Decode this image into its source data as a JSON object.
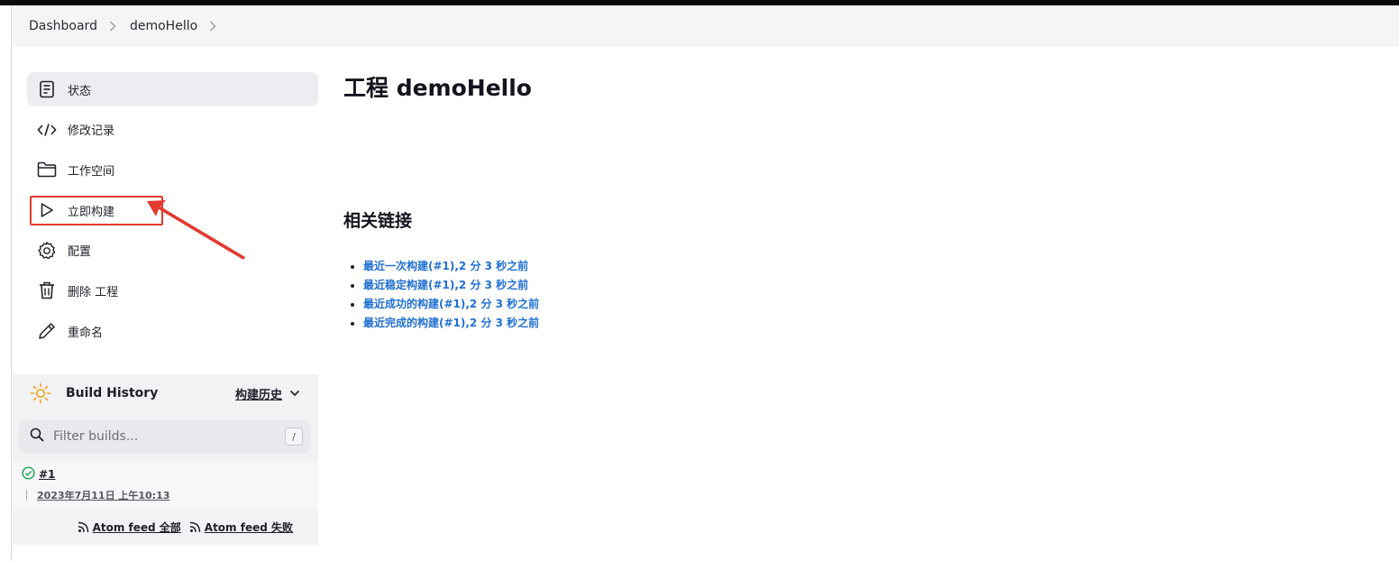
{
  "breadcrumb": {
    "items": [
      "Dashboard",
      "demoHello"
    ]
  },
  "sidebar": {
    "items": [
      {
        "label": "状态",
        "icon": "document-icon"
      },
      {
        "label": "修改记录",
        "icon": "code-icon"
      },
      {
        "label": "工作空间",
        "icon": "folder-icon"
      },
      {
        "label": "立即构建",
        "icon": "play-icon"
      },
      {
        "label": "配置",
        "icon": "gear-icon"
      },
      {
        "label": "删除 工程",
        "icon": "trash-icon"
      },
      {
        "label": "重命名",
        "icon": "pencil-icon"
      }
    ]
  },
  "build_history": {
    "title": "Build History",
    "trend_label": "构建历史",
    "filter_placeholder": "Filter builds...",
    "filter_shortcut": "/",
    "builds": [
      {
        "number": "#1",
        "date": "2023年7月11日 上午10:13",
        "status": "success"
      }
    ],
    "feeds": {
      "all": "Atom feed 全部",
      "failures": "Atom feed 失败"
    }
  },
  "main": {
    "title": "工程 demoHello",
    "related_title": "相关链接",
    "links": [
      "最近一次构建(#1),2 分 3 秒之前",
      "最近稳定构建(#1),2 分 3 秒之前",
      "最近成功的构建(#1),2 分 3 秒之前",
      "最近完成的构建(#1),2 分 3 秒之前"
    ]
  },
  "colors": {
    "accent_link": "#1f6fd1",
    "highlight": "#e33a2f",
    "success": "#1ea64b"
  }
}
